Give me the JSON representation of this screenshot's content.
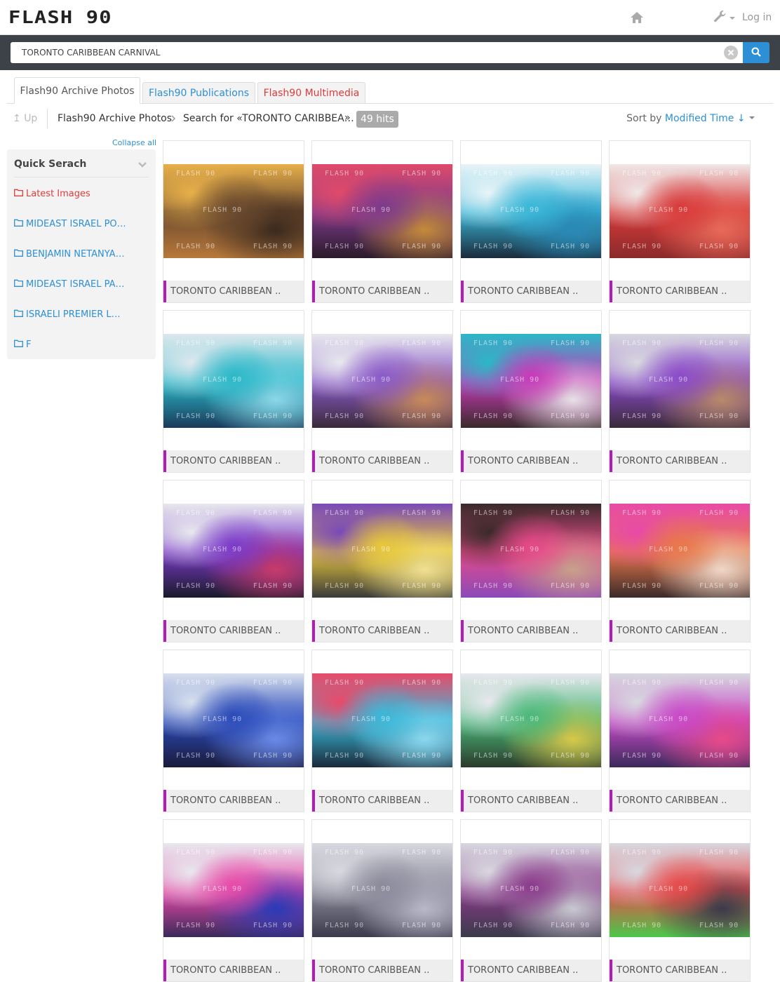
{
  "header": {
    "logo_text": "FLASH 90",
    "login_label": "Log in",
    "home_icon": "home-icon",
    "tools_icon": "wrench-icon"
  },
  "search": {
    "value": "TORONTO CARIBBEAN CARNIVAL",
    "clear_icon": "clear-icon",
    "search_icon": "search-icon"
  },
  "tabs": [
    {
      "label": "Flash90 Archive Photos",
      "active": true
    },
    {
      "label": "Flash90 Publications",
      "active": false
    },
    {
      "label": "Flash90 Multimedia",
      "active": false
    }
  ],
  "breadcrumb": {
    "up_label": "Up",
    "root": "Flash90 Archive Photos",
    "search_prefix": "Search for",
    "search_term": "«TORONTO CARIBBEA…",
    "close_quote": "»",
    "hits": "49 hits"
  },
  "sort": {
    "label": "Sort by",
    "value": "Modified Time"
  },
  "sidebar": {
    "collapse_all": "Collapse all",
    "title": "Quick Serach",
    "items": [
      {
        "label": "Latest Images",
        "color": "#e03b3b"
      },
      {
        "label": "MIDEAST ISRAEL PO…",
        "color": "#2d8fd5"
      },
      {
        "label": "BENJAMIN NETANYA…",
        "color": "#2d8fd5"
      },
      {
        "label": "MIDEAST ISRAEL PA…",
        "color": "#2d8fd5"
      },
      {
        "label": "ISRAELI PREMIER L…",
        "color": "#2d8fd5"
      },
      {
        "label": "F",
        "color": "#2d8fd5"
      }
    ]
  },
  "grid": {
    "watermark": "FLASH 90",
    "caption_accent": "#b21bb8",
    "cards": [
      {
        "caption": "TORONTO CARIBBEAN ..",
        "palette": [
          "#6b4a2e",
          "#e8b04a",
          "#b8783a",
          "#3b2a1e"
        ]
      },
      {
        "caption": "TORONTO CARIBBEAN ..",
        "palette": [
          "#7d3a8c",
          "#e04a6a",
          "#2a1a2a",
          "#c48a3a"
        ]
      },
      {
        "caption": "TORONTO CARIBBEAN ..",
        "palette": [
          "#3ab7d8",
          "#e8f4f8",
          "#1a2a3a",
          "#2a8ab8"
        ]
      },
      {
        "caption": "TORONTO CARIBBEAN ..",
        "palette": [
          "#d83a3a",
          "#f0e8e8",
          "#8a2a2a",
          "#e86a5a"
        ]
      },
      {
        "caption": "TORONTO CARIBBEAN ..",
        "palette": [
          "#2ab8c8",
          "#dde8ee",
          "#1a3a5a",
          "#8ad8e8"
        ]
      },
      {
        "caption": "TORONTO CARIBBEAN ..",
        "palette": [
          "#8a5ac8",
          "#e8e8ee",
          "#3a2a3a",
          "#c88a5a"
        ]
      },
      {
        "caption": "TORONTO CARIBBEAN ..",
        "palette": [
          "#c83ab8",
          "#2ab8c8",
          "#3a2a2a",
          "#e8e0e8"
        ]
      },
      {
        "caption": "TORONTO CARIBBEAN ..",
        "palette": [
          "#8a4ac8",
          "#d8d8e0",
          "#3a2a3a",
          "#b88a6a"
        ]
      },
      {
        "caption": "TORONTO CARIBBEAN ..",
        "palette": [
          "#7a3ac8",
          "#e8e8ee",
          "#1a1a2a",
          "#c83a6a"
        ]
      },
      {
        "caption": "TORONTO CARIBBEAN ..",
        "palette": [
          "#e8c83a",
          "#7a4ab8",
          "#3a3a3a",
          "#f0e090"
        ]
      },
      {
        "caption": "TORONTO CARIBBEAN ..",
        "palette": [
          "#e84a8a",
          "#3a2a2a",
          "#8a4ab8",
          "#c8a08a"
        ]
      },
      {
        "caption": "TORONTO CARIBBEAN ..",
        "palette": [
          "#e8784a",
          "#e84aa8",
          "#3a2a2a",
          "#f0d8c8"
        ]
      },
      {
        "caption": "TORONTO CARIBBEAN ..",
        "palette": [
          "#2a4ab8",
          "#d8e0ee",
          "#1a1a3a",
          "#6a8ae8"
        ]
      },
      {
        "caption": "TORONTO CARIBBEAN ..",
        "palette": [
          "#3ab8d8",
          "#e84a6a",
          "#1a2a3a",
          "#8ad8f0"
        ]
      },
      {
        "caption": "TORONTO CARIBBEAN ..",
        "palette": [
          "#4ab87a",
          "#e8e8ee",
          "#2a3a2a",
          "#d8c84a"
        ]
      },
      {
        "caption": "TORONTO CARIBBEAN ..",
        "palette": [
          "#c84ac8",
          "#d8d8e0",
          "#3a2a5a",
          "#e84a8a"
        ]
      },
      {
        "caption": "TORONTO CARIBBEAN ..",
        "palette": [
          "#e84aa8",
          "#e8e8ee",
          "#3a2a5a",
          "#2a3ab8"
        ]
      },
      {
        "caption": "TORONTO CARIBBEAN ..",
        "palette": [
          "#8a8a9a",
          "#d8d8e0",
          "#3a3a4a",
          "#b8b8c8"
        ]
      },
      {
        "caption": "TORONTO CARIBBEAN ..",
        "palette": [
          "#8a3a8a",
          "#d8d8e0",
          "#3a3a4a",
          "#c8c8d0"
        ]
      },
      {
        "caption": "TORONTO CARIBBEAN ..",
        "palette": [
          "#e84a4a",
          "#d8d8e0",
          "#4ac84a",
          "#3a3a4a"
        ]
      }
    ]
  }
}
